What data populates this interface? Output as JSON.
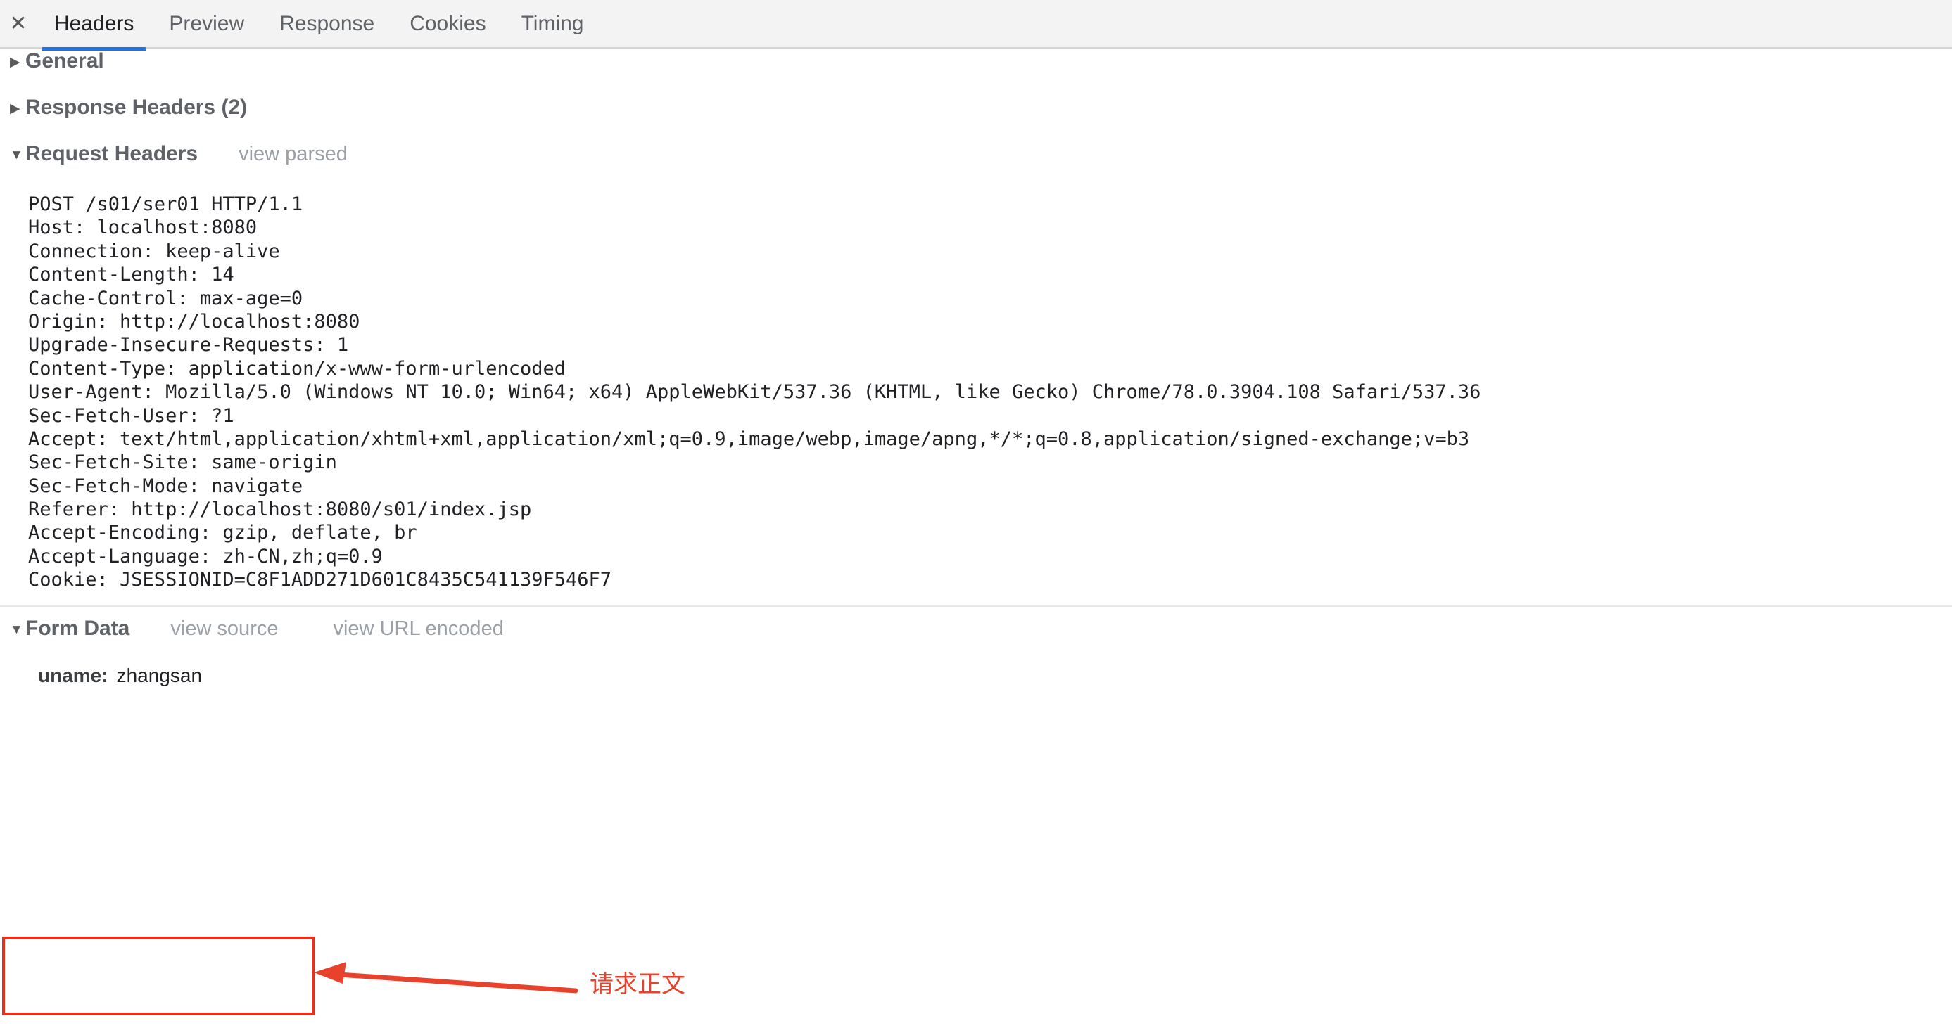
{
  "tabbar": {
    "close_icon": "close-icon",
    "close_glyph": "✕",
    "tabs": [
      {
        "label": "Headers",
        "active": true
      },
      {
        "label": "Preview",
        "active": false
      },
      {
        "label": "Response",
        "active": false
      },
      {
        "label": "Cookies",
        "active": false
      },
      {
        "label": "Timing",
        "active": false
      }
    ],
    "active_underline_color": "#1a73e8",
    "background_color": "#f3f3f3"
  },
  "sections": {
    "general": {
      "title": "General",
      "triangle": "▶",
      "expanded": false
    },
    "response_headers": {
      "title": "Response Headers (2)",
      "triangle": "▶",
      "expanded": false
    },
    "request_headers": {
      "title": "Request Headers",
      "triangle": "▼",
      "expanded": true,
      "view_link": "view parsed",
      "lines": [
        "POST /s01/ser01 HTTP/1.1",
        "Host: localhost:8080",
        "Connection: keep-alive",
        "Content-Length: 14",
        "Cache-Control: max-age=0",
        "Origin: http://localhost:8080",
        "Upgrade-Insecure-Requests: 1",
        "Content-Type: application/x-www-form-urlencoded",
        "User-Agent: Mozilla/5.0 (Windows NT 10.0; Win64; x64) AppleWebKit/537.36 (KHTML, like Gecko) Chrome/78.0.3904.108 Safari/537.36",
        "Sec-Fetch-User: ?1",
        "Accept: text/html,application/xhtml+xml,application/xml;q=0.9,image/webp,image/apng,*/*;q=0.8,application/signed-exchange;v=b3",
        "Sec-Fetch-Site: same-origin",
        "Sec-Fetch-Mode: navigate",
        "Referer: http://localhost:8080/s01/index.jsp",
        "Accept-Encoding: gzip, deflate, br",
        "Accept-Language: zh-CN,zh;q=0.9",
        "Cookie: JSESSIONID=C8F1ADD271D601C8435C541139F546F7"
      ]
    },
    "form_data": {
      "title": "Form Data",
      "triangle": "▼",
      "expanded": true,
      "view_source_link": "view source",
      "view_url_encoded_link": "view URL encoded",
      "entries": [
        {
          "key": "uname:",
          "value": "zhangsan"
        }
      ]
    }
  },
  "annotation": {
    "label": "请求正文",
    "color": "#e8412c",
    "box_color": "#e8311a",
    "shape": "rectangle-with-arrow"
  }
}
